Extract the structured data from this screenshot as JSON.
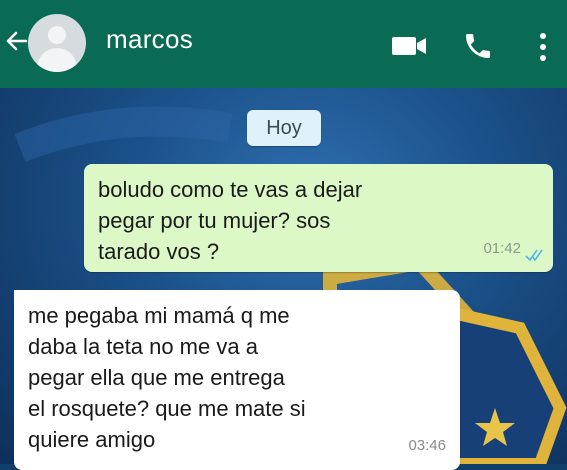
{
  "header": {
    "contact_name": "marcos",
    "background_color": "#0a6b54",
    "icons": [
      "back-arrow-icon",
      "avatar",
      "video-call-icon",
      "phone-icon",
      "more-options-icon"
    ]
  },
  "chat": {
    "date_label": "Hoy",
    "messages": [
      {
        "direction": "outgoing",
        "text": "boludo como te vas a dejar\npegar por tu mujer? sos\ntarado vos ?",
        "time": "01:42",
        "status": "read",
        "bubble_color": "#dcf8c6"
      },
      {
        "direction": "incoming",
        "text": "me pegaba mi mamá q me\ndaba la teta no me va a\npegar ella que me entrega\nel rosquete? que me mate si\nquiere amigo",
        "time": "03:46",
        "bubble_color": "#ffffff"
      }
    ]
  }
}
